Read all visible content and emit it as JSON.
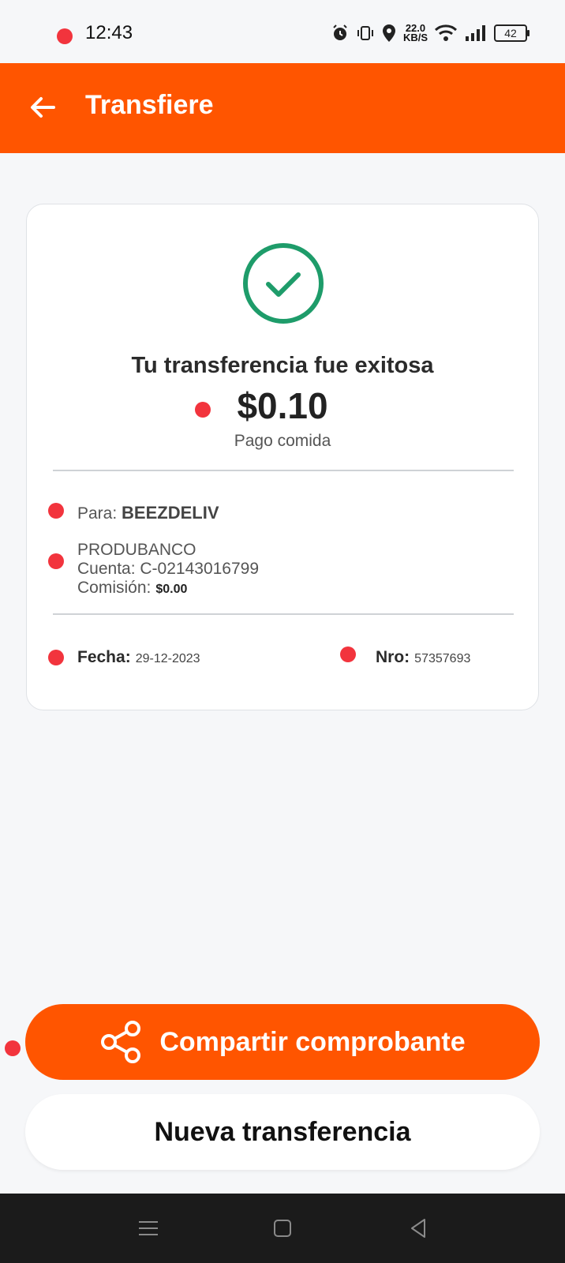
{
  "status_bar": {
    "time": "12:43",
    "net_speed_value": "22.0",
    "net_speed_unit": "KB/S",
    "battery": "42"
  },
  "header": {
    "title": "Transfiere"
  },
  "receipt": {
    "success_message": "Tu transferencia fue exitosa",
    "amount": "$0.10",
    "concept": "Pago comida",
    "recipient_label": "Para:",
    "recipient_name": "BEEZDELIV",
    "bank": "PRODUBANCO",
    "account": "Cuenta: C-02143016799",
    "fee_label": "Comisión:",
    "fee_value": "$0.00",
    "date_label": "Fecha:",
    "date_value": "29-12-2023",
    "number_label": "Nro:",
    "number_value": "57357693"
  },
  "actions": {
    "share_label": "Compartir comprobante",
    "new_transfer_label": "Nueva transferencia"
  },
  "colors": {
    "brand": "#ff5500",
    "success": "#1e9c6a",
    "marker": "#f2343d"
  }
}
